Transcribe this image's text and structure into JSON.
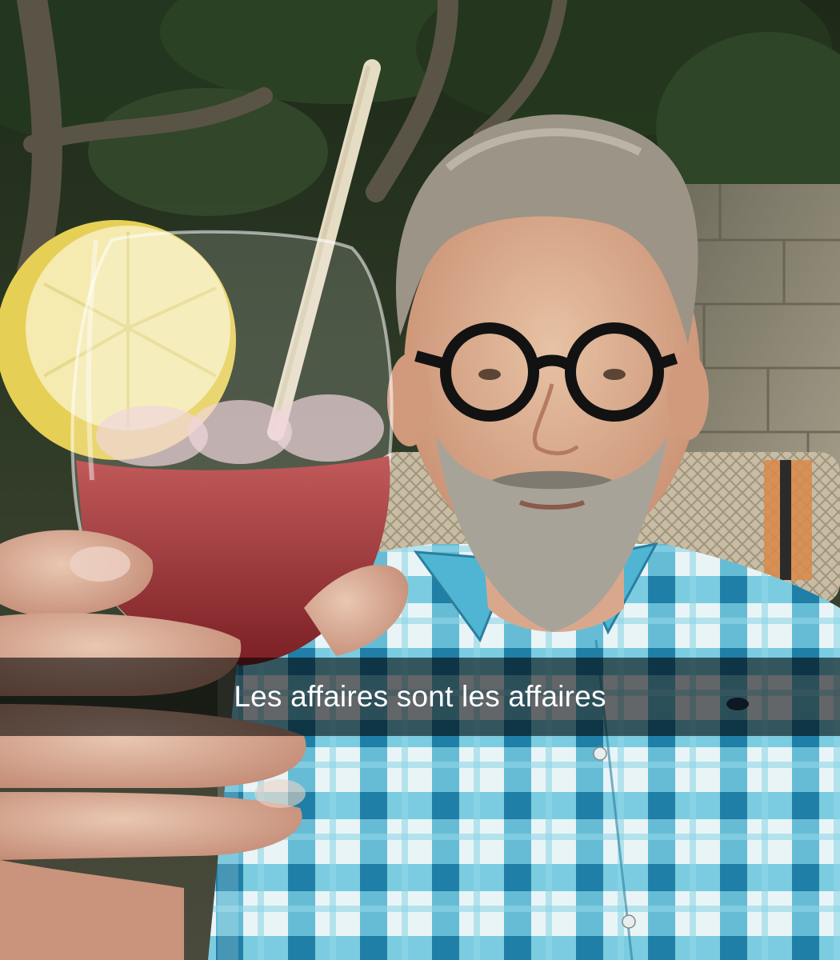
{
  "caption": {
    "text": "Les affaires sont les affaires"
  },
  "colors": {
    "foliage": "#2a3a22",
    "wall": "#8f8a78",
    "drink": "#9e3a3a",
    "lemon": "#e9d866",
    "shirt": "#3fb0cf",
    "glasses": "#111111",
    "caption_bar": "#000000"
  }
}
